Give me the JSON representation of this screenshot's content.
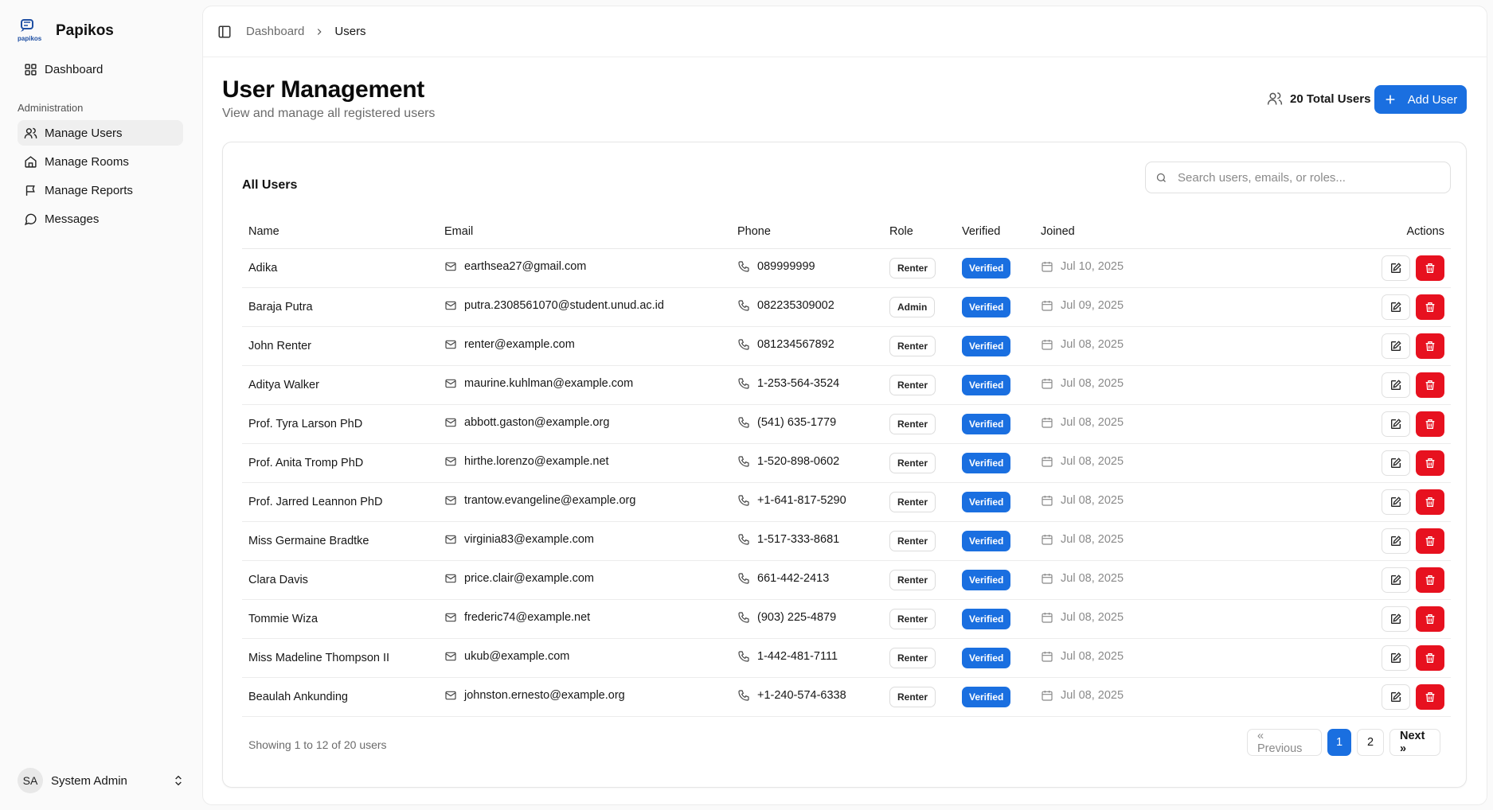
{
  "app": {
    "name": "Papikos",
    "logo_text": "papikos"
  },
  "sidebar": {
    "dashboard_label": "Dashboard",
    "section_label": "Administration",
    "items": [
      {
        "label": "Manage Users",
        "icon": "users-icon",
        "active": true
      },
      {
        "label": "Manage Rooms",
        "icon": "home-icon"
      },
      {
        "label": "Manage Reports",
        "icon": "flag-icon"
      },
      {
        "label": "Messages",
        "icon": "message-icon"
      }
    ],
    "user": {
      "initials": "SA",
      "name": "System Admin"
    }
  },
  "breadcrumb": {
    "parent": "Dashboard",
    "current": "Users"
  },
  "header": {
    "title": "User Management",
    "subtitle": "View and manage all registered users",
    "total_users": "20 Total Users",
    "add_button": "Add User"
  },
  "card": {
    "title": "All Users",
    "search_placeholder": "Search users, emails, or roles...",
    "columns": [
      "Name",
      "Email",
      "Phone",
      "Role",
      "Verified",
      "Joined",
      "Actions"
    ]
  },
  "users": [
    {
      "name": "Adika",
      "email": "earthsea27@gmail.com",
      "phone": "089999999",
      "role": "Renter",
      "verified": "Verified",
      "joined": "Jul 10, 2025"
    },
    {
      "name": "Baraja Putra",
      "email": "putra.2308561070@student.unud.ac.id",
      "phone": "082235309002",
      "role": "Admin",
      "verified": "Verified",
      "joined": "Jul 09, 2025"
    },
    {
      "name": "John Renter",
      "email": "renter@example.com",
      "phone": "081234567892",
      "role": "Renter",
      "verified": "Verified",
      "joined": "Jul 08, 2025"
    },
    {
      "name": "Aditya Walker",
      "email": "maurine.kuhlman@example.com",
      "phone": "1-253-564-3524",
      "role": "Renter",
      "verified": "Verified",
      "joined": "Jul 08, 2025"
    },
    {
      "name": "Prof. Tyra Larson PhD",
      "email": "abbott.gaston@example.org",
      "phone": "(541) 635-1779",
      "role": "Renter",
      "verified": "Verified",
      "joined": "Jul 08, 2025"
    },
    {
      "name": "Prof. Anita Tromp PhD",
      "email": "hirthe.lorenzo@example.net",
      "phone": "1-520-898-0602",
      "role": "Renter",
      "verified": "Verified",
      "joined": "Jul 08, 2025"
    },
    {
      "name": "Prof. Jarred Leannon PhD",
      "email": "trantow.evangeline@example.org",
      "phone": "+1-641-817-5290",
      "role": "Renter",
      "verified": "Verified",
      "joined": "Jul 08, 2025"
    },
    {
      "name": "Miss Germaine Bradtke",
      "email": "virginia83@example.com",
      "phone": "1-517-333-8681",
      "role": "Renter",
      "verified": "Verified",
      "joined": "Jul 08, 2025"
    },
    {
      "name": "Clara Davis",
      "email": "price.clair@example.com",
      "phone": "661-442-2413",
      "role": "Renter",
      "verified": "Verified",
      "joined": "Jul 08, 2025"
    },
    {
      "name": "Tommie Wiza",
      "email": "frederic74@example.net",
      "phone": "(903) 225-4879",
      "role": "Renter",
      "verified": "Verified",
      "joined": "Jul 08, 2025"
    },
    {
      "name": "Miss Madeline Thompson II",
      "email": "ukub@example.com",
      "phone": "1-442-481-7111",
      "role": "Renter",
      "verified": "Verified",
      "joined": "Jul 08, 2025"
    },
    {
      "name": "Beaulah Ankunding",
      "email": "johnston.ernesto@example.org",
      "phone": "+1-240-574-6338",
      "role": "Renter",
      "verified": "Verified",
      "joined": "Jul 08, 2025"
    }
  ],
  "footer": {
    "showing": "Showing 1 to 12 of 20 users",
    "prev": "« Previous",
    "pages": [
      "1",
      "2"
    ],
    "current_page": "1",
    "next": "Next »"
  },
  "colors": {
    "accent": "#1a6fe0",
    "danger": "#e7111f"
  }
}
